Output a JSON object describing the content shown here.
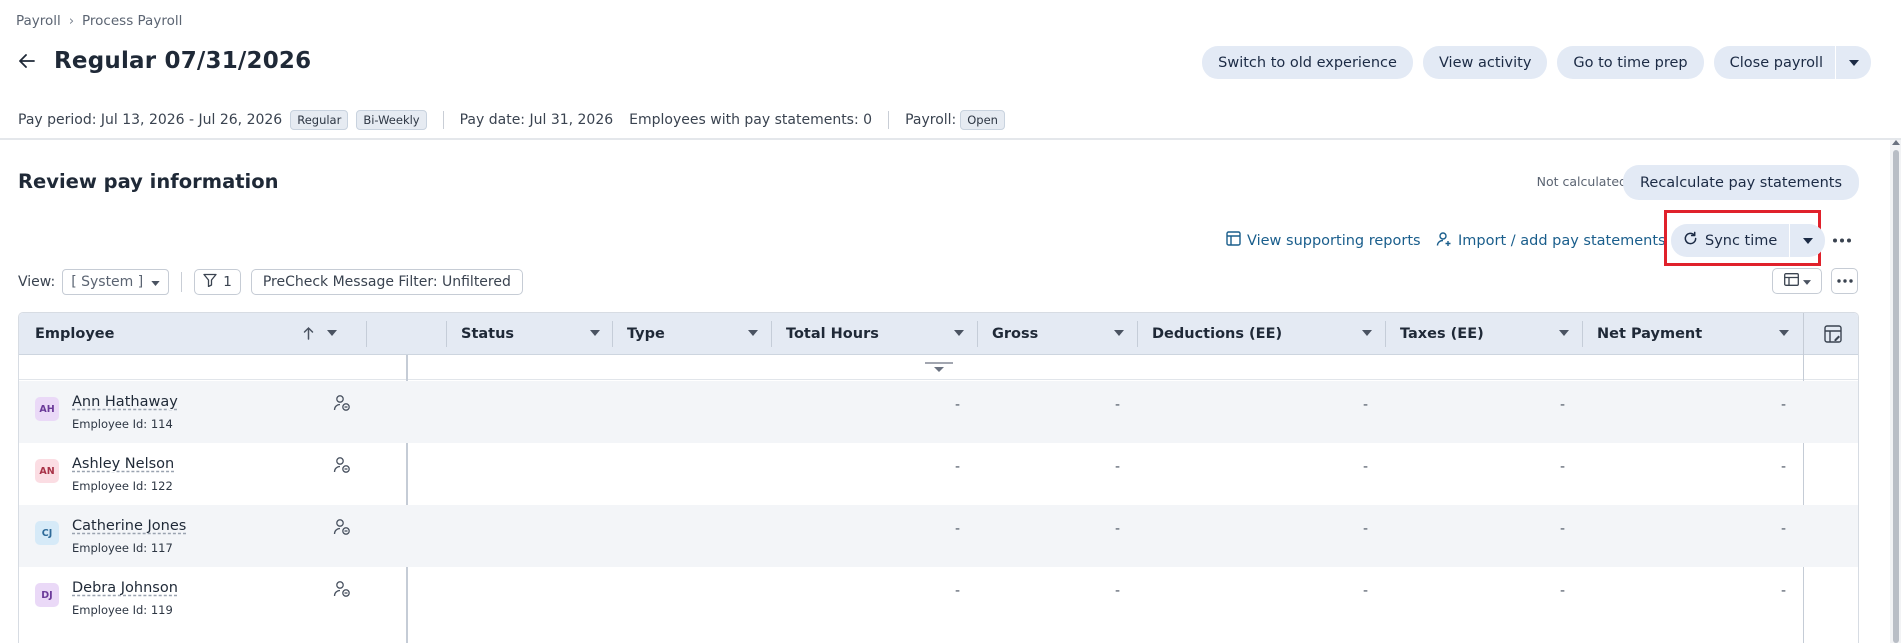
{
  "breadcrumb": {
    "root": "Payroll",
    "current": "Process Payroll"
  },
  "page": {
    "title": "Regular 07/31/2026"
  },
  "top_actions": {
    "switch": "Switch to old experience",
    "activity": "View activity",
    "time_prep": "Go to time prep",
    "close": "Close payroll"
  },
  "info": {
    "pay_period": "Pay period: Jul 13, 2026 - Jul 26, 2026",
    "tag_regular": "Regular",
    "tag_biweekly": "Bi-Weekly",
    "pay_date": "Pay date: Jul 31, 2026",
    "employees_with_statements": "Employees with pay statements: 0",
    "payroll_label": "Payroll:",
    "payroll_status": "Open"
  },
  "review": {
    "title": "Review pay information",
    "calc_status": "Not calculated",
    "recalc_label": "Recalculate pay statements"
  },
  "toolbar": {
    "supporting_reports": "View supporting reports",
    "import_add": "Import / add pay statements",
    "sync_time": "Sync time"
  },
  "view_bar": {
    "label": "View:",
    "selected": "[ System ]",
    "filter_count": "1",
    "precheck": "PreCheck Message Filter: Unfiltered"
  },
  "table": {
    "columns": {
      "employee": "Employee",
      "status": "Status",
      "type": "Type",
      "total_hours": "Total Hours",
      "gross": "Gross",
      "deductions": "Deductions (EE)",
      "taxes": "Taxes (EE)",
      "net": "Net Payment"
    },
    "rows": [
      {
        "initials": "AH",
        "name": "Ann Hathaway",
        "id": "Employee Id: 114",
        "avatar_bg": "#ead9f7",
        "avatar_fg": "#6b3a99",
        "hours": "-",
        "gross": "-",
        "deductions": "-",
        "taxes": "-",
        "net": "-"
      },
      {
        "initials": "AN",
        "name": "Ashley Nelson",
        "id": "Employee Id: 122",
        "avatar_bg": "#fbdde3",
        "avatar_fg": "#a83247",
        "hours": "-",
        "gross": "-",
        "deductions": "-",
        "taxes": "-",
        "net": "-"
      },
      {
        "initials": "CJ",
        "name": "Catherine Jones",
        "id": "Employee Id: 117",
        "avatar_bg": "#d6eaf8",
        "avatar_fg": "#2e6a99",
        "hours": "-",
        "gross": "-",
        "deductions": "-",
        "taxes": "-",
        "net": "-"
      },
      {
        "initials": "DJ",
        "name": "Debra Johnson",
        "id": "Employee Id: 119",
        "avatar_bg": "#ead9f7",
        "avatar_fg": "#6b3a99",
        "hours": "-",
        "gross": "-",
        "deductions": "-",
        "taxes": "-",
        "net": "-"
      }
    ]
  },
  "colors": {
    "accent_link": "#1a5e8c",
    "pill_bg": "#e3eaf5",
    "highlight": "#e0212b"
  }
}
